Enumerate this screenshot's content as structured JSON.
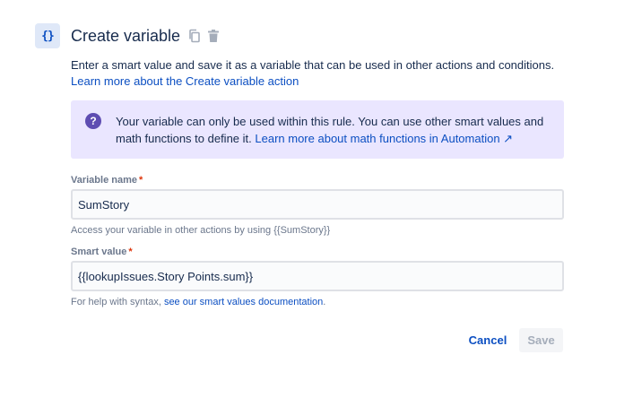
{
  "header": {
    "icon_glyph": "{}",
    "title": "Create variable",
    "actions": [
      {
        "name": "copy-icon"
      },
      {
        "name": "trash-icon"
      }
    ]
  },
  "description": {
    "text": "Enter a smart value and save it as a variable that can be used in other actions and conditions.",
    "link": "Learn more about the Create variable action"
  },
  "info_panel": {
    "text": "Your variable can only be used within this rule. You can use other smart values and math functions to define it.",
    "link": "Learn more about math functions in Automation ↗",
    "icon_glyph": "?"
  },
  "variable_name": {
    "label": "Variable name",
    "required_marker": "*",
    "value": "SumStory",
    "help": "Access your variable in other actions by using {{SumStory}}"
  },
  "smart_value": {
    "label": "Smart value",
    "required_marker": "*",
    "value": "{{lookupIssues.Story Points.sum}}",
    "help_prefix": "For help with syntax,",
    "help_link": "see our smart values documentation",
    "help_suffix": "."
  },
  "footer": {
    "cancel_label": "Cancel",
    "save_label": "Save"
  },
  "colors": {
    "accent": "#0c4fc2",
    "info_bg": "#eae6ff",
    "info_icon": "#5e4db2",
    "required": "#de350b"
  }
}
